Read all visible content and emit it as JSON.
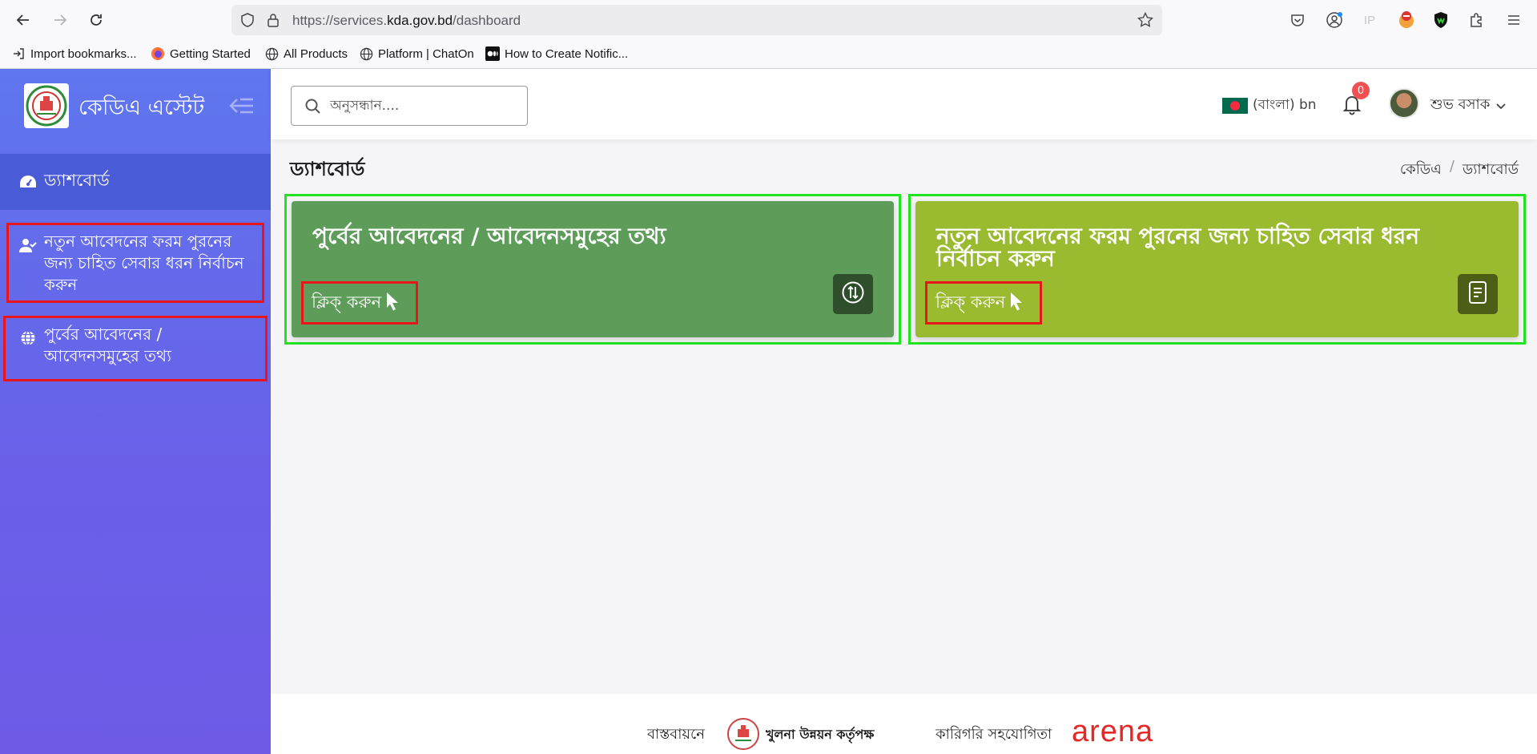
{
  "browser": {
    "url_prefix": "https://services.",
    "url_domain": "kda.gov.bd",
    "url_path": "/dashboard",
    "bookmarks": [
      {
        "label": "Import bookmarks..."
      },
      {
        "label": "Getting Started"
      },
      {
        "label": "All Products"
      },
      {
        "label": "Platform | ChatOn"
      },
      {
        "label": "How to Create Notific..."
      }
    ],
    "ip_label": "IP"
  },
  "sidebar": {
    "brand_title": "কেডিএ এস্টেট",
    "items": [
      {
        "label": "ড্যাশবোর্ড",
        "icon": "speedometer-icon"
      },
      {
        "label": "নতুন আবেদনের ফরম পুরনের জন্য চাহিত সেবার ধরন নির্বাচন করুন",
        "icon": "user-check-icon"
      },
      {
        "label": "পুর্বের আবেদনের / আবেদনসমুহের তথ্য",
        "icon": "globe-icon"
      }
    ]
  },
  "header": {
    "search_placeholder": "অনুসন্ধান....",
    "language": "(বাংলা) bn",
    "notification_count": "0",
    "user_name": "শুভ বসাক"
  },
  "page": {
    "title": "ড্যাশবোর্ড",
    "breadcrumb": [
      "কেডিএ",
      "/",
      "ড্যাশবোর্ড"
    ]
  },
  "cards": [
    {
      "title": "পুর্বের আবেদনের / আবেদনসমুহের তথ্য",
      "cta": "ক্লিক্ করুন",
      "color": "#5d9c59",
      "button_color": "#2f4f2c"
    },
    {
      "title": "নতুন আবেদনের ফরম পুরনের জন্য চাহিত সেবার ধরন নির্বাচন করুন",
      "cta": "ক্লিক্ করুন",
      "color": "#9aba2f",
      "button_color": "#4d5e16"
    }
  ],
  "footer": {
    "implemented_by_label": "বাস্তবায়নে",
    "implementer": "খুলনা উন্নয়ন কর্তৃপক্ষ",
    "tech_support_label": "কারিগরি সহযোগিতা",
    "tech_partner": "arena"
  },
  "colors": {
    "sidebar_top": "#5f76ee",
    "sidebar_bottom": "#6d5be6",
    "highlight_red": "#e8161c",
    "highlight_green": "#22e322"
  }
}
